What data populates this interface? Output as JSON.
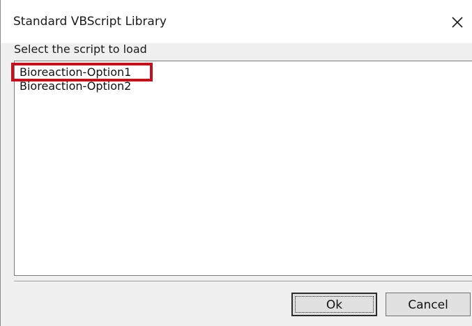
{
  "dialog": {
    "title": "Standard VBScript Library",
    "close_icon": "close-x-icon",
    "prompt": "Select the script to load"
  },
  "scripts": {
    "items": [
      {
        "label": "Bioreaction-Option1",
        "highlighted": true
      },
      {
        "label": "Bioreaction-Option2",
        "highlighted": false
      }
    ]
  },
  "buttons": {
    "ok_label": "Ok",
    "cancel_label": "Cancel"
  },
  "colors": {
    "highlight": "#c0111f",
    "dialog_bg": "#f0f0f0",
    "list_bg": "#ffffff"
  }
}
